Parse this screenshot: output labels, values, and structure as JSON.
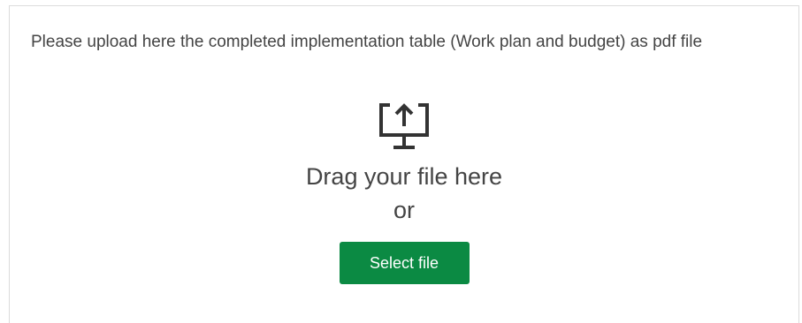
{
  "upload": {
    "instructions": "Please upload here the completed implementation table (Work plan and budget) as pdf file",
    "icon": "monitor-upload-icon",
    "drag_text": "Drag your file here",
    "or_text": "or",
    "button_label": "Select file"
  },
  "colors": {
    "button_bg": "#0b8a43",
    "button_text": "#ffffff",
    "text": "#444444",
    "border": "#dcdcdc"
  }
}
